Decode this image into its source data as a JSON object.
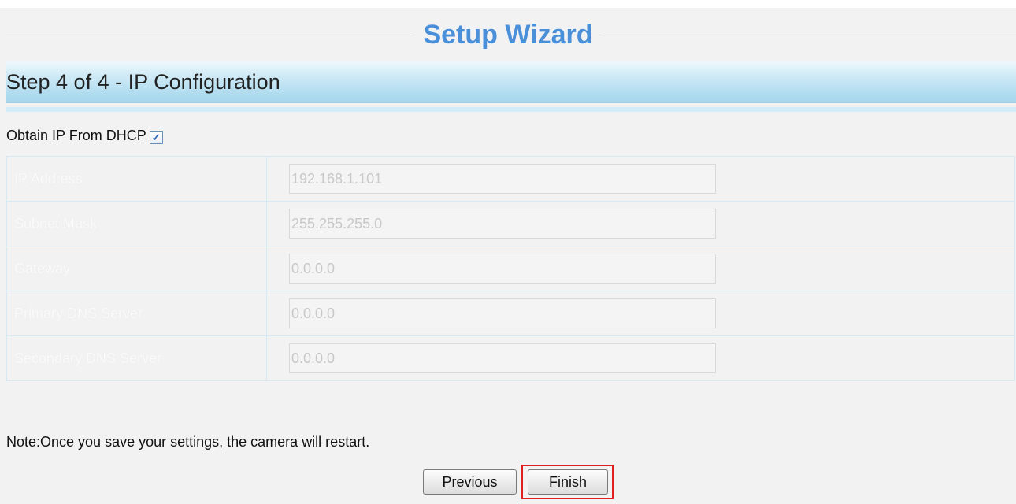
{
  "wizard": {
    "title": "Setup Wizard",
    "step_title": "Step 4 of 4 - IP Configuration"
  },
  "dhcp": {
    "label": "Obtain IP From DHCP",
    "checked": true
  },
  "fields": [
    {
      "label": "IP Address",
      "value": "192.168.1.101"
    },
    {
      "label": "Subnet Mask",
      "value": "255.255.255.0"
    },
    {
      "label": "Gateway",
      "value": "0.0.0.0"
    },
    {
      "label": "Primary DNS Server",
      "value": "0.0.0.0"
    },
    {
      "label": "Secondary DNS Server",
      "value": "0.0.0.0"
    }
  ],
  "note": "Note:Once you save your settings, the camera will restart.",
  "buttons": {
    "previous_label": "Previous",
    "finish_label": "Finish"
  },
  "colors": {
    "title": "#4a8fd9",
    "step_bar": "#b3ddf0",
    "highlight": "#e02020"
  }
}
